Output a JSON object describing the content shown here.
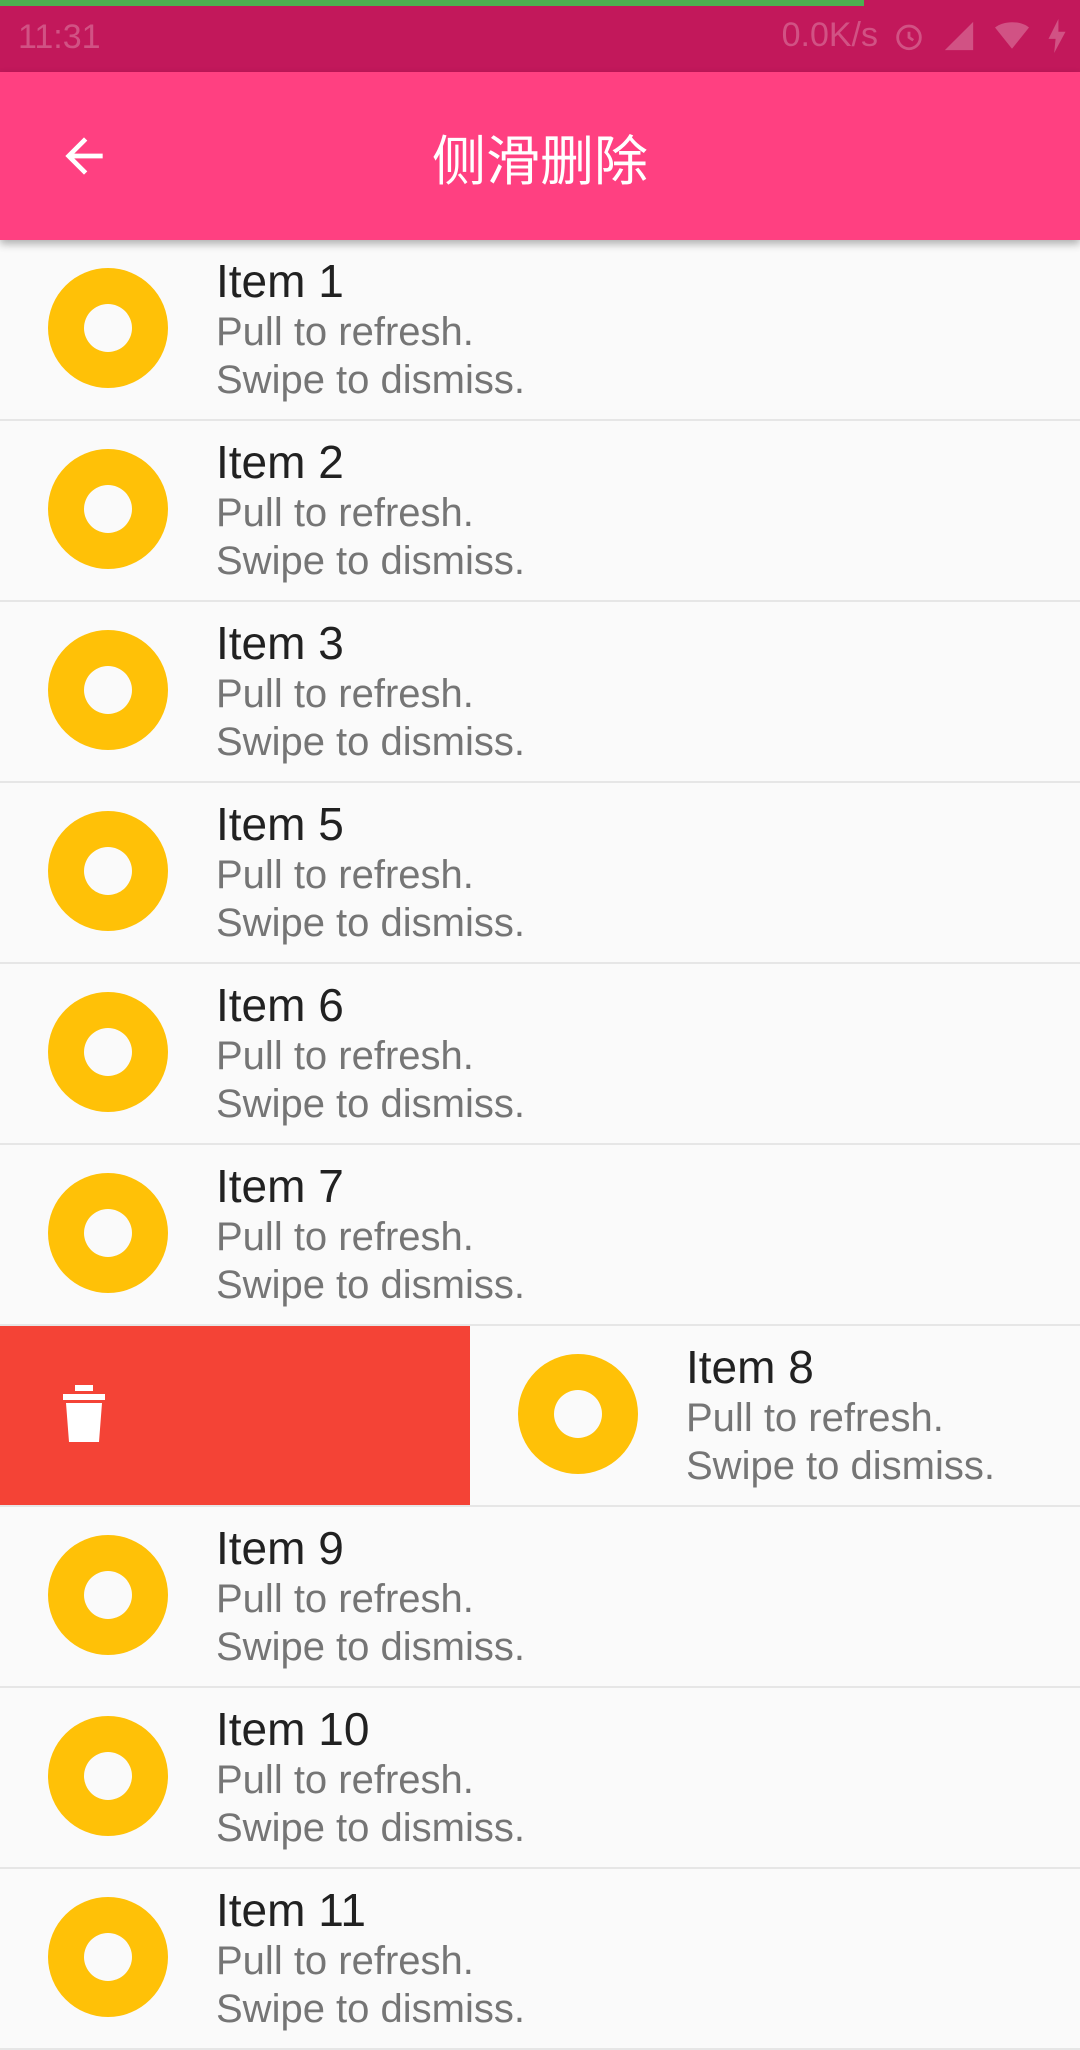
{
  "status_bar": {
    "time": "11:31",
    "speed": "0.0K/s",
    "icons": [
      "alarm-icon",
      "signal-icon",
      "wifi-icon",
      "charging-icon"
    ]
  },
  "app_bar": {
    "title": "侧滑删除",
    "back_icon": "arrow-left-icon"
  },
  "colors": {
    "status_bar": "#c2185b",
    "app_bar": "#ff4081",
    "avatar": "#ffc107",
    "delete_background": "#f44336",
    "progress": "#4caf50"
  },
  "list": {
    "items": [
      {
        "title": "Item 1",
        "line1": "Pull to refresh.",
        "line2": "Swipe to dismiss."
      },
      {
        "title": "Item 2",
        "line1": "Pull to refresh.",
        "line2": "Swipe to dismiss."
      },
      {
        "title": "Item 3",
        "line1": "Pull to refresh.",
        "line2": "Swipe to dismiss."
      },
      {
        "title": "Item 5",
        "line1": "Pull to refresh.",
        "line2": "Swipe to dismiss."
      },
      {
        "title": "Item 6",
        "line1": "Pull to refresh.",
        "line2": "Swipe to dismiss."
      },
      {
        "title": "Item 7",
        "line1": "Pull to refresh.",
        "line2": "Swipe to dismiss."
      },
      {
        "title": "Item 8",
        "line1": "Pull to refresh.",
        "line2": "Swipe to dismiss.",
        "swiped": true
      },
      {
        "title": "Item 9",
        "line1": "Pull to refresh.",
        "line2": "Swipe to dismiss."
      },
      {
        "title": "Item 10",
        "line1": "Pull to refresh.",
        "line2": "Swipe to dismiss."
      },
      {
        "title": "Item 11",
        "line1": "Pull to refresh.",
        "line2": "Swipe to dismiss."
      }
    ],
    "delete_icon": "trash-icon"
  }
}
